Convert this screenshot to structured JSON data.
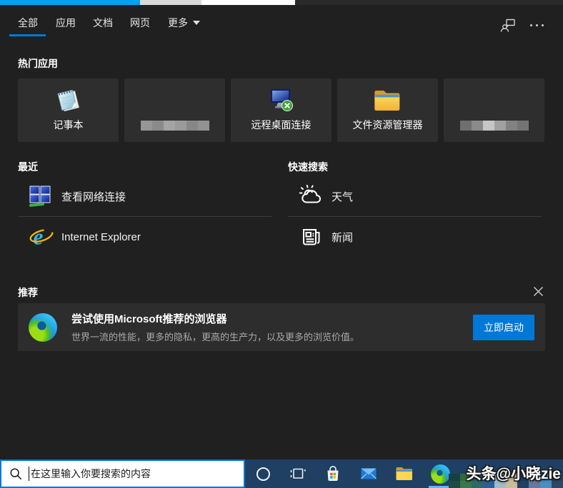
{
  "colors": {
    "accent_blue": "#0078d7",
    "flyout_bg": "#202020",
    "tile_bg": "#2e2e2e",
    "taskbar_bg": "#1f3f63",
    "top_strip_blue": "#00a2ed"
  },
  "tabs": {
    "items": [
      {
        "label": "全部",
        "active": true
      },
      {
        "label": "应用",
        "active": false
      },
      {
        "label": "文档",
        "active": false
      },
      {
        "label": "网页",
        "active": false
      },
      {
        "label": "更多",
        "active": false,
        "has_dropdown": true
      }
    ],
    "right_icons": [
      "feedback-icon",
      "more-options-icon"
    ]
  },
  "hot_apps": {
    "title": "热门应用",
    "tiles": [
      {
        "label": "记事本",
        "icon": "notepad-icon"
      },
      {
        "label": "",
        "icon": "blurred-blue-app-icon",
        "blurred": true
      },
      {
        "label": "远程桌面连接",
        "icon": "remote-desktop-icon"
      },
      {
        "label": "文件资源管理器",
        "icon": "file-explorer-icon"
      },
      {
        "label": "",
        "icon": "blurred-red-app-icon",
        "blurred": true
      }
    ]
  },
  "recent": {
    "title": "最近",
    "items": [
      {
        "label": "查看网络连接",
        "icon": "network-connections-icon"
      },
      {
        "label": "Internet Explorer",
        "icon": "internet-explorer-icon"
      }
    ]
  },
  "quick_search": {
    "title": "快速搜索",
    "items": [
      {
        "label": "天气",
        "icon": "weather-icon"
      },
      {
        "label": "新闻",
        "icon": "news-icon"
      }
    ]
  },
  "recommended": {
    "title": "推荐",
    "close_icon": "close-icon",
    "banner": {
      "icon": "edge-icon",
      "title": "尝试使用Microsoft推荐的浏览器",
      "subtitle": "世界一流的性能，更多的隐私，更高的生产力，以及更多的浏览价值。",
      "button_label": "立即启动"
    }
  },
  "taskbar": {
    "search_placeholder": "在这里输入你要搜索的内容",
    "icons": [
      "search-icon",
      "cortana-icon",
      "task-view-icon",
      "store-icon",
      "mail-icon",
      "file-explorer-icon",
      "edge-icon"
    ],
    "watermark": "头条@小晓zie"
  }
}
